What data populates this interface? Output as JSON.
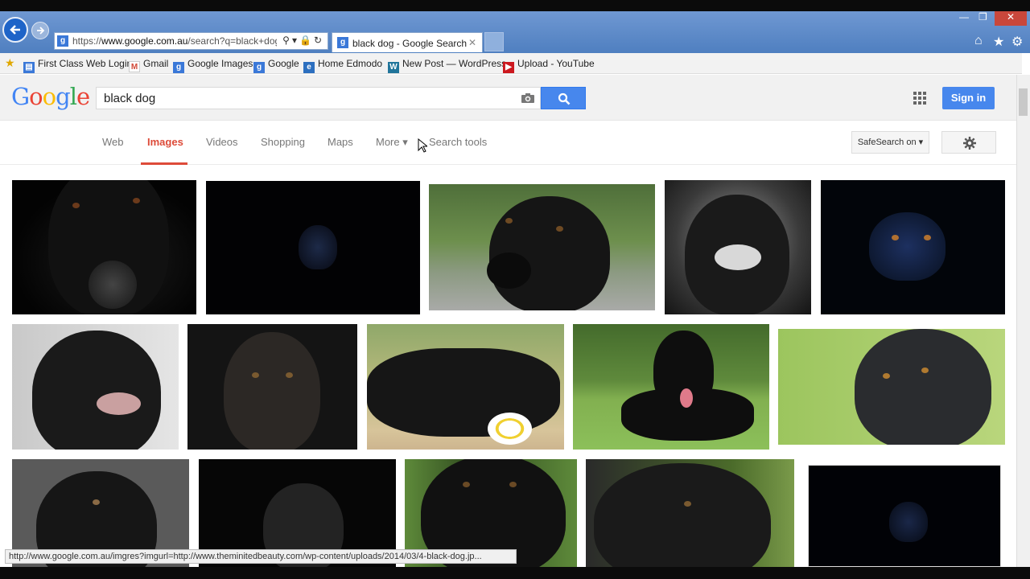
{
  "browser": {
    "address_url_prefix": "https://",
    "address_url_host": "www.google.com.au",
    "address_url_rest": "/search?q=black+dog&",
    "tab_title": "black dog - Google Search",
    "status_url": "http://www.google.com.au/imgres?imgurl=http://www.theminitedbeauty.com/wp-content/uploads/2014/03/4-black-dog.jp..."
  },
  "favorites": [
    {
      "label": "First Class Web Login",
      "icon": "page-icon",
      "color": "#3a78d8"
    },
    {
      "label": "Gmail",
      "icon": "gmail-icon",
      "color": "#d14836"
    },
    {
      "label": "Google Images",
      "icon": "google-icon",
      "color": "#3a78d8"
    },
    {
      "label": "Google",
      "icon": "google-icon",
      "color": "#3a78d8"
    },
    {
      "label": "Home  Edmodo",
      "icon": "edmodo-icon",
      "color": "#2c6fbf"
    },
    {
      "label": "New Post — WordPress",
      "icon": "wordpress-icon",
      "color": "#21759b"
    },
    {
      "label": "Upload - YouTube",
      "icon": "youtube-icon",
      "color": "#cc181e"
    }
  ],
  "google": {
    "logo": [
      "G",
      "o",
      "o",
      "g",
      "l",
      "e"
    ],
    "search_value": "black dog",
    "sign_in": "Sign in"
  },
  "nav": {
    "items": [
      "Web",
      "Images",
      "Videos",
      "Shopping",
      "Maps",
      "More ▾",
      "Search tools"
    ],
    "active": "Images",
    "safesearch": "SafeSearch on ▾"
  },
  "results": {
    "count": 15,
    "accent_colors": {
      "brand_blue": "#4787ed",
      "active_red": "#dd4b39"
    }
  }
}
